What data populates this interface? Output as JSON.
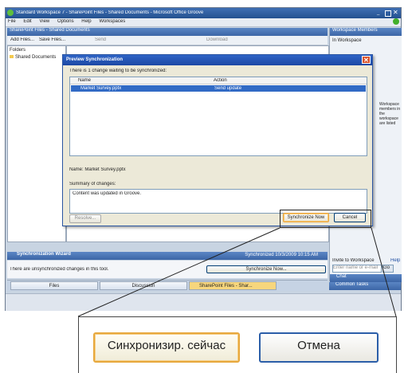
{
  "window": {
    "title": "Standard Workspace 7 - SharePoint Files - Shared Documents - Microsoft Office Groove",
    "menu": [
      "File",
      "Edit",
      "View",
      "Options",
      "Help",
      "Workspaces"
    ]
  },
  "files_panel": {
    "header": "SharePoint Files - Shared Documents",
    "toolbar": [
      "Add Files...",
      "Save Files...",
      "Send",
      "Download"
    ],
    "folders_label": "Folders",
    "folder_item": "Shared Documents"
  },
  "right_panel": {
    "header": "Workspace Members",
    "item": "In Workspace",
    "text": "Workspace members in the workspace are listed below.",
    "invite_label": "Invite to Workspace",
    "invite_help": "Help",
    "invite_placeholder": "Enter name or e-mail",
    "invite_go": "Go",
    "chat_label": "Chat",
    "common_tasks": "Common Tasks"
  },
  "dialog": {
    "title": "Preview Synchronization",
    "description": "There is 1 change waiting to be synchronized:",
    "col_name": "Name",
    "col_action": "Action",
    "row_name": "Market Survey.pptx",
    "row_action": "Send update",
    "name_label": "Name:",
    "name_value": "Market Survey.pptx",
    "summary_label": "Summary of changes:",
    "summary_text": "Content was updated in Groove.",
    "resolve_button": "Resolve...",
    "sync_button": "Synchronize Now",
    "cancel_button": "Cancel"
  },
  "sync_bar": {
    "title": "Synchronization Wizard",
    "status": "Synchronized 10/3/2009 10:15 AM",
    "message": "There are unsynchronized changes in this tool.",
    "sync_now_button": "Synchronize Now..."
  },
  "tabs": [
    "Files",
    "Discussion",
    "SharePoint Files - Shar..."
  ],
  "zoom": {
    "sync_button": "Синхронизир. сейчас",
    "cancel_button": "Отмена"
  }
}
